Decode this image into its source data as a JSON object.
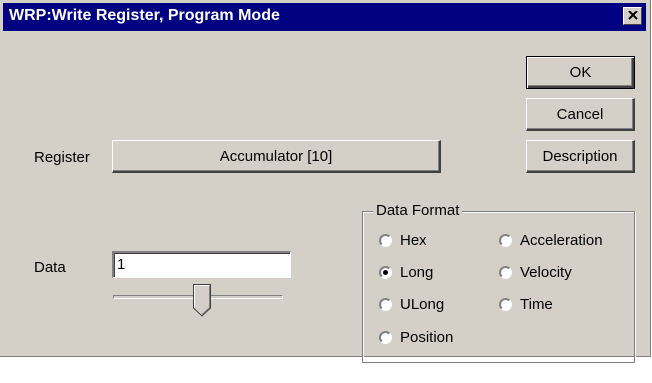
{
  "window": {
    "title": "WRP:Write Register, Program Mode"
  },
  "buttons": {
    "ok": "OK",
    "cancel": "Cancel",
    "description": "Description"
  },
  "register": {
    "label": "Register",
    "value": "Accumulator [10]"
  },
  "data": {
    "label": "Data",
    "value": "1",
    "slider_value": 0.5
  },
  "data_format": {
    "title": "Data Format",
    "options": [
      {
        "label": "Hex",
        "selected": false
      },
      {
        "label": "Long",
        "selected": true
      },
      {
        "label": "ULong",
        "selected": false
      },
      {
        "label": "Position",
        "selected": false
      },
      {
        "label": "Acceleration",
        "selected": false
      },
      {
        "label": "Velocity",
        "selected": false
      },
      {
        "label": "Time",
        "selected": false
      }
    ]
  },
  "icons": {
    "close": "close-icon",
    "radio": "radio-button",
    "slider_thumb": "slider-thumb"
  },
  "colors": {
    "title_bar": "#000080",
    "face": "#d4d0c8"
  }
}
